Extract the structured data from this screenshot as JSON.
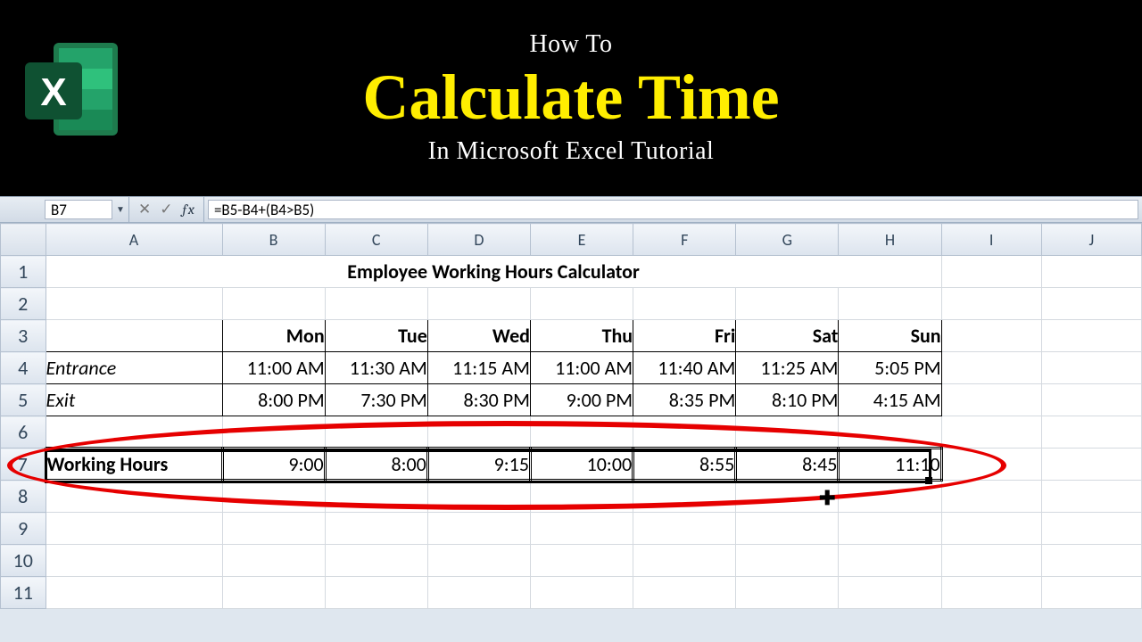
{
  "banner": {
    "line1": "How To",
    "line2": "Calculate Time",
    "line3": "In Microsoft Excel Tutorial"
  },
  "formula_bar": {
    "name_box": "B7",
    "fx_label": "ƒx",
    "formula": "=B5-B4+(B4>B5)"
  },
  "columns": [
    "A",
    "B",
    "C",
    "D",
    "E",
    "F",
    "G",
    "H",
    "I",
    "J"
  ],
  "row_headers": [
    "1",
    "2",
    "3",
    "4",
    "5",
    "6",
    "7",
    "8",
    "9",
    "10",
    "11"
  ],
  "sheet": {
    "title": "Employee Working Hours Calculator",
    "days": [
      "Mon",
      "Tue",
      "Wed",
      "Thu",
      "Fri",
      "Sat",
      "Sun"
    ],
    "rows_labels": {
      "entrance": "Entrance",
      "exit": "Exit",
      "working_hours": "Working Hours"
    },
    "entrance": [
      "11:00 AM",
      "11:30 AM",
      "11:15 AM",
      "11:00 AM",
      "11:40 AM",
      "11:25 AM",
      "5:05 PM"
    ],
    "exit": [
      "8:00 PM",
      "7:30 PM",
      "8:30 PM",
      "9:00 PM",
      "8:35 PM",
      "8:10 PM",
      "4:15 AM"
    ],
    "working_hours": [
      "9:00",
      "8:00",
      "9:15",
      "10:00",
      "8:55",
      "8:45",
      "11:10"
    ]
  },
  "selection": {
    "range": "A7:H7"
  },
  "chart_data": {
    "type": "table",
    "title": "Employee Working Hours Calculator",
    "categories": [
      "Mon",
      "Tue",
      "Wed",
      "Thu",
      "Fri",
      "Sat",
      "Sun"
    ],
    "series": [
      {
        "name": "Entrance",
        "values": [
          "11:00 AM",
          "11:30 AM",
          "11:15 AM",
          "11:00 AM",
          "11:40 AM",
          "11:25 AM",
          "5:05 PM"
        ]
      },
      {
        "name": "Exit",
        "values": [
          "8:00 PM",
          "7:30 PM",
          "8:30 PM",
          "9:00 PM",
          "8:35 PM",
          "8:10 PM",
          "4:15 AM"
        ]
      },
      {
        "name": "Working Hours",
        "values": [
          "9:00",
          "8:00",
          "9:15",
          "10:00",
          "8:55",
          "8:45",
          "11:10"
        ]
      }
    ]
  }
}
